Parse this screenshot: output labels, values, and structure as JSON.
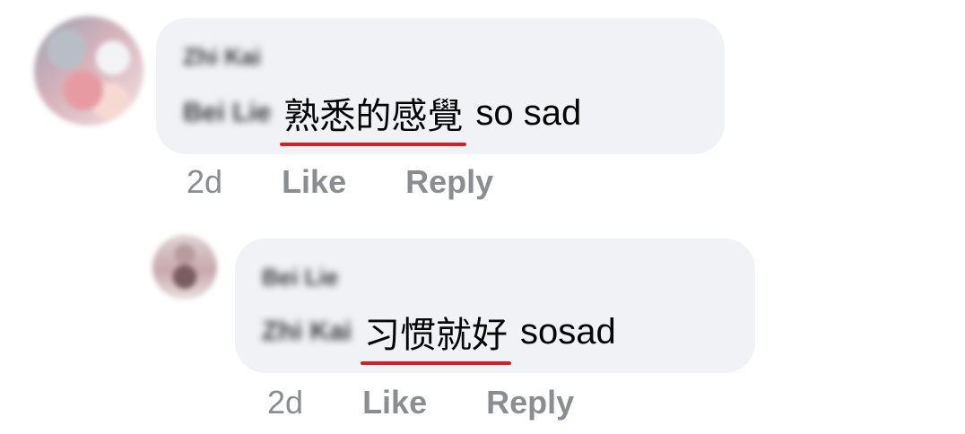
{
  "comments": [
    {
      "author": "Zhi Kai",
      "mention": "Bei Lie",
      "highlighted_text": "熟悉的感覺",
      "text": "so sad",
      "time": "2d",
      "like_label": "Like",
      "reply_label": "Reply"
    },
    {
      "author": "Bei Lie",
      "mention": "Zhi Kai",
      "highlighted_text": "习惯就好",
      "text": "sosad",
      "time": "2d",
      "like_label": "Like",
      "reply_label": "Reply"
    }
  ],
  "colors": {
    "bubble": "#f0f2f5",
    "underline": "#d32027",
    "meta": "#8a8d91",
    "text": "#050505"
  }
}
